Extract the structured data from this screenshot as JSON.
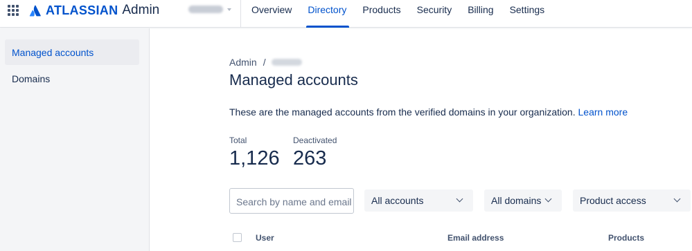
{
  "header": {
    "logo_brand": "ATLASSIAN",
    "logo_product": "Admin",
    "org_name": "",
    "nav": [
      {
        "label": "Overview",
        "active": false
      },
      {
        "label": "Directory",
        "active": true
      },
      {
        "label": "Products",
        "active": false
      },
      {
        "label": "Security",
        "active": false
      },
      {
        "label": "Billing",
        "active": false
      },
      {
        "label": "Settings",
        "active": false
      }
    ]
  },
  "sidebar": {
    "items": [
      {
        "label": "Managed accounts",
        "active": true
      },
      {
        "label": "Domains",
        "active": false
      }
    ]
  },
  "main": {
    "breadcrumb": {
      "root": "Admin",
      "separator": "/",
      "org": ""
    },
    "title": "Managed accounts",
    "description": "These are the managed accounts from the verified domains in your organization.",
    "learn_more": "Learn more",
    "stats": [
      {
        "label": "Total",
        "value": "1,126"
      },
      {
        "label": "Deactivated",
        "value": "263"
      }
    ],
    "search": {
      "placeholder": "Search by name and email"
    },
    "filters": [
      {
        "value": "All accounts"
      },
      {
        "value": "All domains"
      },
      {
        "value": "Product access"
      }
    ],
    "table": {
      "columns": [
        "User",
        "Email address",
        "Products"
      ]
    }
  },
  "colors": {
    "accent": "#0052cc",
    "text": "#172b4d",
    "sidebar_bg": "#f4f5f7"
  }
}
